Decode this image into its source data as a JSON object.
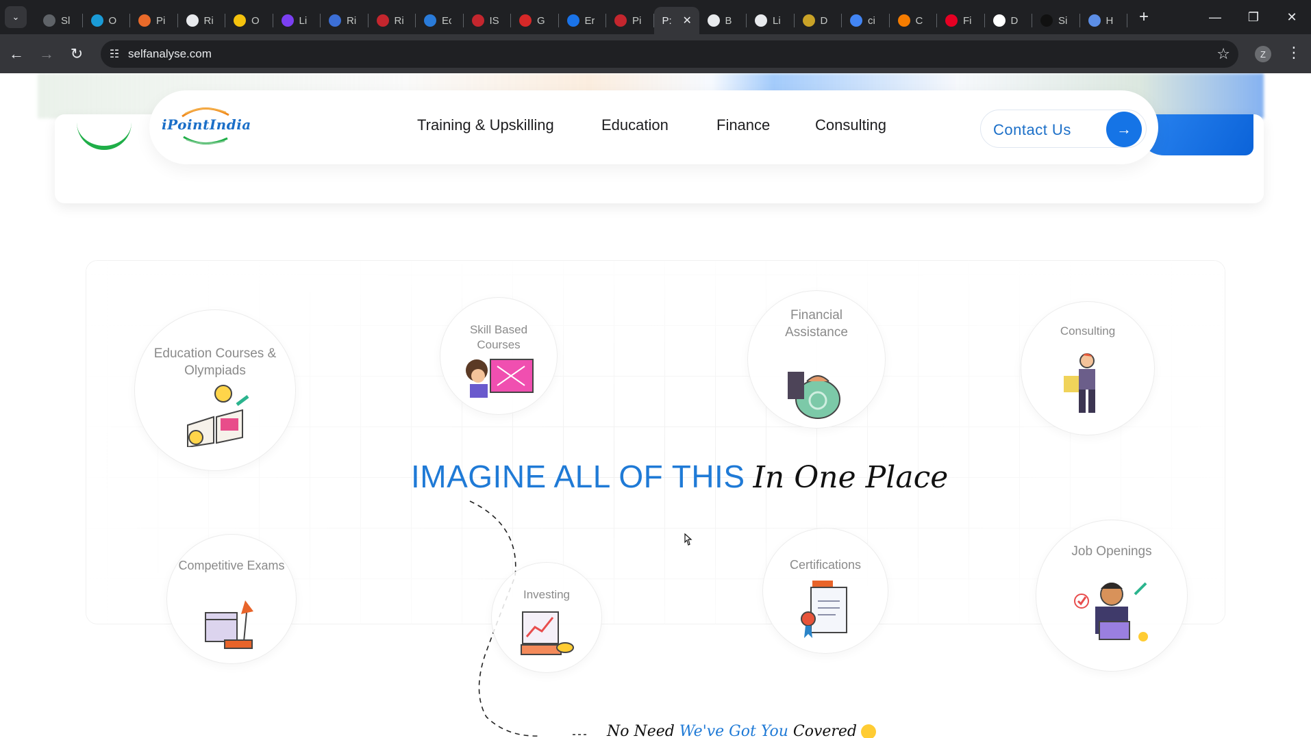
{
  "browser": {
    "tabs": [
      {
        "title": "Sl",
        "favicon_color": "#5f6368"
      },
      {
        "title": "O",
        "favicon_color": "#1a9bd7"
      },
      {
        "title": "Pi",
        "favicon_color": "#e96a2a"
      },
      {
        "title": "Ri",
        "favicon_color": "#e8eaed"
      },
      {
        "title": "O",
        "favicon_color": "#f4c20d"
      },
      {
        "title": "Li",
        "favicon_color": "#7b3ff2"
      },
      {
        "title": "Ri",
        "favicon_color": "#3c6fd6"
      },
      {
        "title": "Ri",
        "favicon_color": "#c4262e"
      },
      {
        "title": "Ec",
        "favicon_color": "#2a7bd9"
      },
      {
        "title": "IS",
        "favicon_color": "#c4262e"
      },
      {
        "title": "G",
        "favicon_color": "#d62828"
      },
      {
        "title": "Er",
        "favicon_color": "#1a73e8"
      },
      {
        "title": "Pi",
        "favicon_color": "#c4262e"
      },
      {
        "title": "P:",
        "favicon_color": "#35363a",
        "active": true
      },
      {
        "title": "B",
        "favicon_color": "#e8eaed"
      },
      {
        "title": "Li",
        "favicon_color": "#e8eaed"
      },
      {
        "title": "D",
        "favicon_color": "#c9a227"
      },
      {
        "title": "ci",
        "favicon_color": "#4285f4"
      },
      {
        "title": "C",
        "favicon_color": "#f57c00"
      },
      {
        "title": "Fi",
        "favicon_color": "#e60023"
      },
      {
        "title": "D",
        "favicon_color": "#ffffff"
      },
      {
        "title": "Si",
        "favicon_color": "#111111"
      },
      {
        "title": "H",
        "favicon_color": "#5c8ee6"
      }
    ],
    "active_tab_close": "✕",
    "new_tab": "+",
    "window_controls": {
      "minimize": "—",
      "restore": "❐",
      "close": "✕"
    },
    "url": "selfanalyse.com",
    "profile_initial": "Z"
  },
  "header": {
    "logo_text": "iPointIndia",
    "nav": [
      "Training & Upskilling",
      "Education",
      "Finance",
      "Consulting"
    ],
    "contact_label": "Contact Us",
    "contact_arrow": "→"
  },
  "bubbles": {
    "education": "Education Courses & Olympiads",
    "skill": "Skill Based Courses",
    "financial": "Financial Assistance",
    "consulting": "Consulting",
    "competitive": "Competitive Exams",
    "investing": "Investing",
    "certifications": "Certifications",
    "jobs": "Job Openings"
  },
  "headline": {
    "main": "IMAGINE ALL OF THIS",
    "script": "In One Place"
  },
  "footer_line": {
    "part1": "No Need ",
    "part2": "We've Got You",
    "part3": " Covered"
  },
  "colors": {
    "accent_blue": "#1f7ad6",
    "button_blue": "#1574e6",
    "chrome_dark": "#1f2023",
    "chrome_toolbar": "#35363a"
  }
}
